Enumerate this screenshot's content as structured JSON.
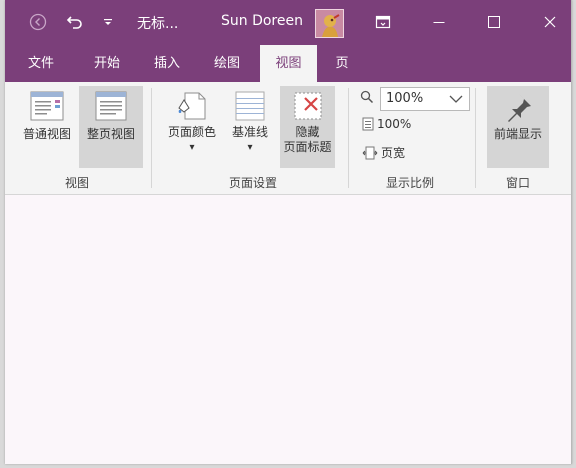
{
  "titlebar": {
    "doc_title": "无标...",
    "user_name": "Sun Doreen"
  },
  "tabs": [
    {
      "label": "文件"
    },
    {
      "label": "开始"
    },
    {
      "label": "插入"
    },
    {
      "label": "绘图"
    },
    {
      "label": "视图",
      "active": true
    },
    {
      "label": "页"
    }
  ],
  "ribbon": {
    "view_group": {
      "label": "视图",
      "normal_view": "普通视图",
      "full_page_view": "整页视图"
    },
    "page_setup_group": {
      "label": "页面设置",
      "page_color": "页面颜色",
      "rule_lines": "基准线",
      "hide_title_line1": "隐藏",
      "hide_title_line2": "页面标题"
    },
    "zoom_group": {
      "label": "显示比例",
      "zoom_value": "100%",
      "zoom_100": "100%",
      "page_width": "页宽"
    },
    "window_group": {
      "label": "窗口",
      "always_on_top": "前端显示"
    }
  },
  "colors": {
    "accent": "#7b3f7a",
    "ribbon_bg": "#f4f4f4",
    "canvas_bg": "#fbf6fa"
  }
}
